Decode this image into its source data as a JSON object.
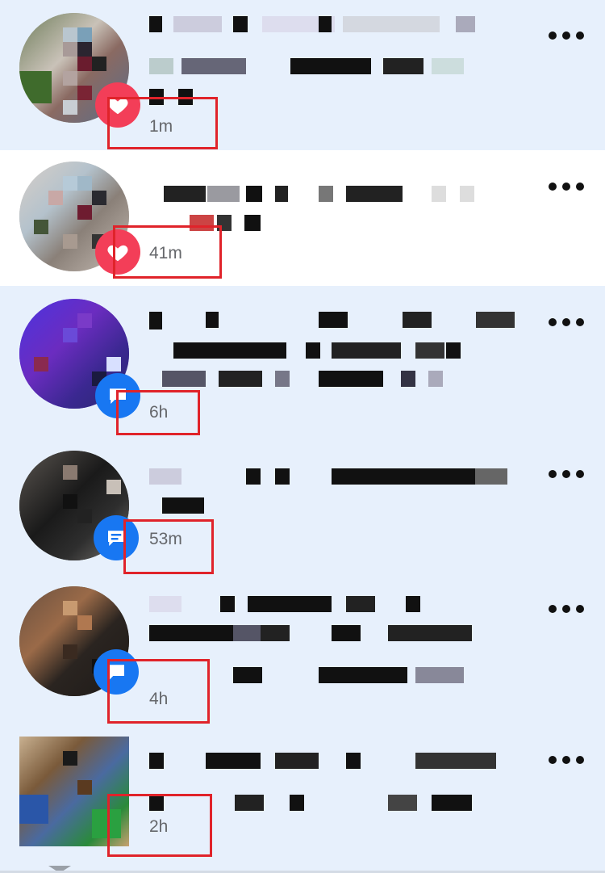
{
  "notifications": [
    {
      "time": "1m",
      "read": false,
      "badge": "heart-icon"
    },
    {
      "time": "41m",
      "read": true,
      "badge": "heart-icon"
    },
    {
      "time": "6h",
      "read": false,
      "badge": "comment-icon"
    },
    {
      "time": "53m",
      "read": false,
      "badge": "comment-icon"
    },
    {
      "time": "4h",
      "read": false,
      "badge": "comment-icon"
    },
    {
      "time": "2h",
      "read": false,
      "badge": "comment-icon"
    }
  ],
  "colors": {
    "unread_bg": "#e7f0fc",
    "read_bg": "#ffffff",
    "highlight": "#e0232a",
    "love_badge": "#f33e58",
    "comment_badge": "#1877f2",
    "time_text": "#65676b"
  }
}
